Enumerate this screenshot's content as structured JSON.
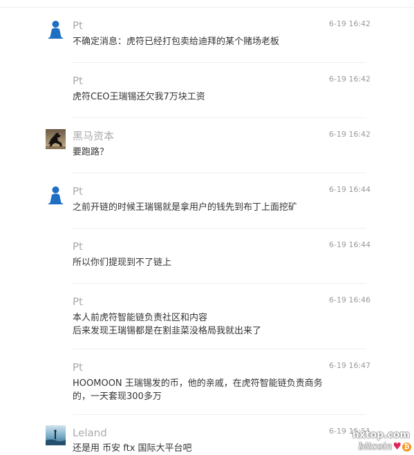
{
  "messages": [
    {
      "sender": "Pt",
      "time": "6-19 16:42",
      "avatar": "person-icon",
      "lines": [
        "不确定消息：虎符已经打包卖给迪拜的某个赌场老板"
      ]
    },
    {
      "sender": "Pt",
      "time": "6-19 16:42",
      "avatar": "",
      "lines": [
        "虎符CEO王瑞锡还欠我7万块工资"
      ]
    },
    {
      "sender": "黑马资本",
      "time": "6-19 16:42",
      "avatar": "black-horse-photo",
      "lines": [
        "要跑路？"
      ]
    },
    {
      "sender": "Pt",
      "time": "6-19 16:44",
      "avatar": "person-icon",
      "lines": [
        "之前开链的时候王瑞锡就是拿用户的钱先到布丁上面挖矿"
      ]
    },
    {
      "sender": "Pt",
      "time": "6-19 16:44",
      "avatar": "",
      "lines": [
        "所以你们提现到不了链上"
      ]
    },
    {
      "sender": "Pt",
      "time": "6-19 16:46",
      "avatar": "",
      "lines": [
        "本人前虎符智能链负责社区和内容",
        "后来发现王瑞锡都是在割韭菜没格局我就出来了"
      ]
    },
    {
      "sender": "Pt",
      "time": "6-19 16:47",
      "avatar": "",
      "lines": [
        "HOOMOON 王瑞锡发的币，他的亲戚，在虎符智能链负责商务",
        "的，一天套现300多万"
      ]
    },
    {
      "sender": "Leland",
      "time": "6-19 16:51",
      "avatar": "landscape-photo",
      "lines": [
        "还是用 币安 ftx 国际大平台吧"
      ]
    }
  ],
  "watermark": {
    "site": "hxtop.com",
    "word": "bitcoin",
    "heart_icon": "heart-icon",
    "coin_icon": "bitcoin-icon",
    "coin_symbol": "₿",
    "heart_symbol": "♥",
    "colors": {
      "heart": "#e0245e",
      "coin": "#f7931a"
    }
  }
}
